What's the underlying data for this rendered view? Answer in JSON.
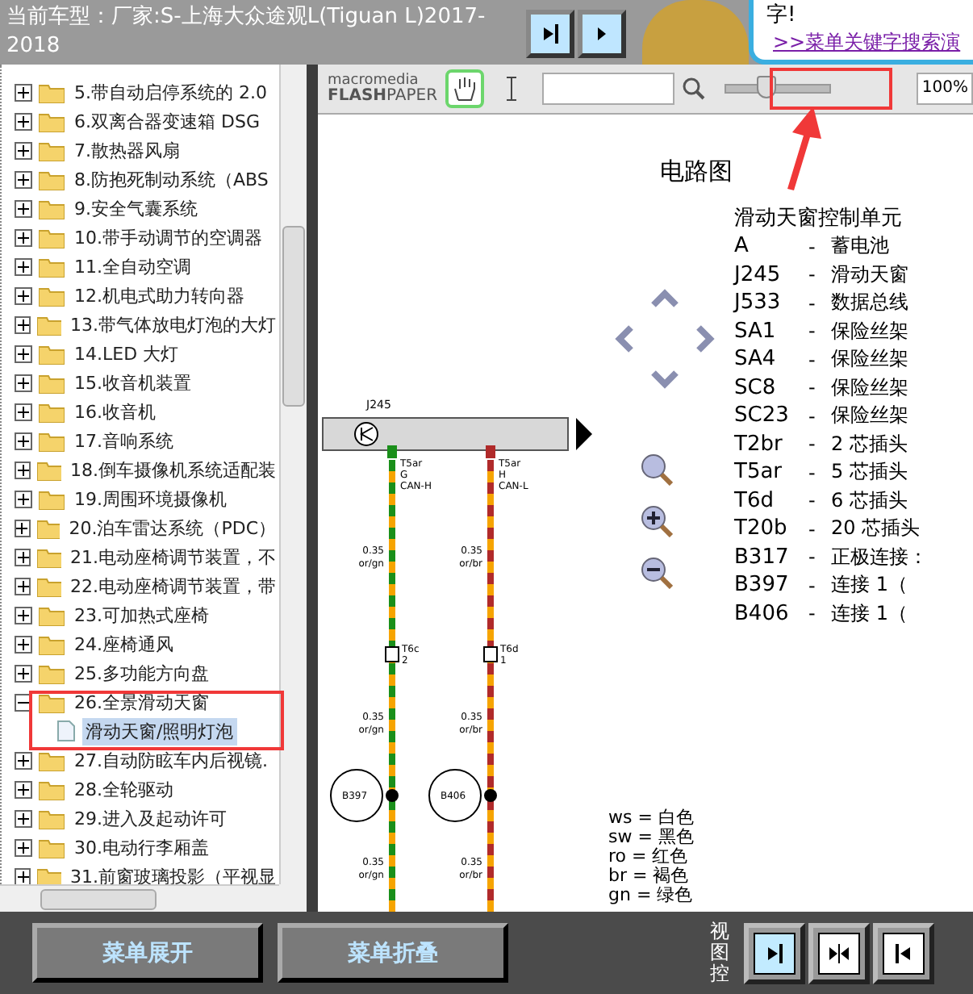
{
  "header": {
    "title": "当前车型：厂家:S-上海大众途观L(Tiguan L)2017-2018",
    "bubble_text": "字!",
    "bubble_link": ">>菜单关键字搜索演"
  },
  "tree": {
    "items": [
      {
        "label": "5.带自动启停系统的 2.0",
        "expanded": false
      },
      {
        "label": "6.双离合器变速箱 DSG",
        "expanded": false
      },
      {
        "label": "7.散热器风扇",
        "expanded": false
      },
      {
        "label": "8.防抱死制动系统（ABS",
        "expanded": false
      },
      {
        "label": "9.安全气囊系统",
        "expanded": false
      },
      {
        "label": "10.带手动调节的空调器",
        "expanded": false
      },
      {
        "label": "11.全自动空调",
        "expanded": false
      },
      {
        "label": "12.机电式助力转向器",
        "expanded": false
      },
      {
        "label": "13.带气体放电灯泡的大灯",
        "expanded": false
      },
      {
        "label": "14.LED 大灯",
        "expanded": false
      },
      {
        "label": "15.收音机装置",
        "expanded": false
      },
      {
        "label": "16.收音机",
        "expanded": false
      },
      {
        "label": "17.音响系统",
        "expanded": false
      },
      {
        "label": "18.倒车摄像机系统适配装",
        "expanded": false
      },
      {
        "label": "19.周围环境摄像机",
        "expanded": false
      },
      {
        "label": "20.泊车雷达系统（PDC）",
        "expanded": false
      },
      {
        "label": "21.电动座椅调节装置，不",
        "expanded": false
      },
      {
        "label": "22.电动座椅调节装置，带",
        "expanded": false
      },
      {
        "label": "23.可加热式座椅",
        "expanded": false
      },
      {
        "label": "24.座椅通风",
        "expanded": false
      },
      {
        "label": "25.多功能方向盘",
        "expanded": false
      },
      {
        "label": "26.全景滑动天窗",
        "expanded": true,
        "children": [
          {
            "label": "滑动天窗/照明灯泡",
            "selected": true
          }
        ]
      },
      {
        "label": "27.自动防眩车内后视镜.",
        "expanded": false
      },
      {
        "label": "28.全轮驱动",
        "expanded": false
      },
      {
        "label": "29.进入及起动许可",
        "expanded": false
      },
      {
        "label": "30.电动行李厢盖",
        "expanded": false
      },
      {
        "label": "31.前窗玻璃投影（平视显",
        "expanded": false
      }
    ]
  },
  "viewer": {
    "toolbar": {
      "logo_top": "macromedia",
      "logo_brand": "FLASH",
      "logo_product": "PAPER",
      "tools": [
        {
          "kind": "hand",
          "selected": true
        },
        {
          "kind": "text",
          "selected": false
        }
      ],
      "zoom": {
        "level": 0.4,
        "value": "100%"
      }
    },
    "document": {
      "heading": "电路图",
      "subtitle": "滑动天窗控制单元",
      "legend_rows": [
        {
          "code": "A",
          "dash": "-",
          "desc": "蓄电池"
        },
        {
          "code": "J245",
          "dash": "-",
          "desc": "滑动天窗"
        },
        {
          "code": "J533",
          "dash": "-",
          "desc": "数据总线"
        },
        {
          "code": "SA1",
          "dash": "-",
          "desc": "保险丝架"
        },
        {
          "code": "SA4",
          "dash": "-",
          "desc": "保险丝架"
        },
        {
          "code": "SC8",
          "dash": "-",
          "desc": "保险丝架"
        },
        {
          "code": "SC23",
          "dash": "-",
          "desc": "保险丝架"
        },
        {
          "code": "T2br",
          "dash": "-",
          "desc": "2 芯插头"
        },
        {
          "code": "T5ar",
          "dash": "-",
          "desc": "5 芯插头"
        },
        {
          "code": "T6d",
          "dash": "-",
          "desc": "6 芯插头"
        },
        {
          "code": "T20b",
          "dash": "-",
          "desc": "20 芯插头"
        },
        {
          "code": "B317",
          "dash": "-",
          "desc": "正极连接："
        },
        {
          "code": "B397",
          "dash": "-",
          "desc": "连接 1（"
        },
        {
          "code": "B406",
          "dash": "-",
          "desc": "连接 1（"
        }
      ],
      "colors": [
        {
          "abbr": "ws",
          "sep": "=",
          "name": "白色"
        },
        {
          "abbr": "sw",
          "sep": "=",
          "name": "黑色"
        },
        {
          "abbr": "ro",
          "sep": "=",
          "name": "红色"
        },
        {
          "abbr": "br",
          "sep": "=",
          "name": "褐色"
        },
        {
          "abbr": "gn",
          "sep": "=",
          "name": "绿色"
        }
      ],
      "diagram": {
        "unit": "J245",
        "wires": [
          {
            "pin": [
              "T5ar",
              "G",
              "CAN-H"
            ],
            "color": "#1a8f1a",
            "connector": [
              "T6c",
              "2"
            ],
            "joint": "B397",
            "labels": [
              {
                "gauge": "0.35",
                "color_code": "or/gn"
              },
              {
                "gauge": "0.35",
                "color_code": "or/gn"
              },
              {
                "gauge": "0.35",
                "color_code": "or/gn"
              }
            ]
          },
          {
            "pin": [
              "T5ar",
              "H",
              "CAN-L"
            ],
            "color": "#b02a2a",
            "connector": [
              "T6d",
              "1"
            ],
            "joint": "B406",
            "labels": [
              {
                "gauge": "0.35",
                "color_code": "or/br"
              },
              {
                "gauge": "0.35",
                "color_code": "or/br"
              },
              {
                "gauge": "0.35",
                "color_code": "or/br"
              }
            ]
          }
        ]
      }
    }
  },
  "footer": {
    "buttons": [
      "菜单展开",
      "菜单折叠"
    ],
    "view_label": "视图控",
    "view_buttons": [
      {
        "kind": "right",
        "selected": true
      },
      {
        "kind": "split",
        "selected": false
      },
      {
        "kind": "left",
        "selected": false
      }
    ]
  }
}
